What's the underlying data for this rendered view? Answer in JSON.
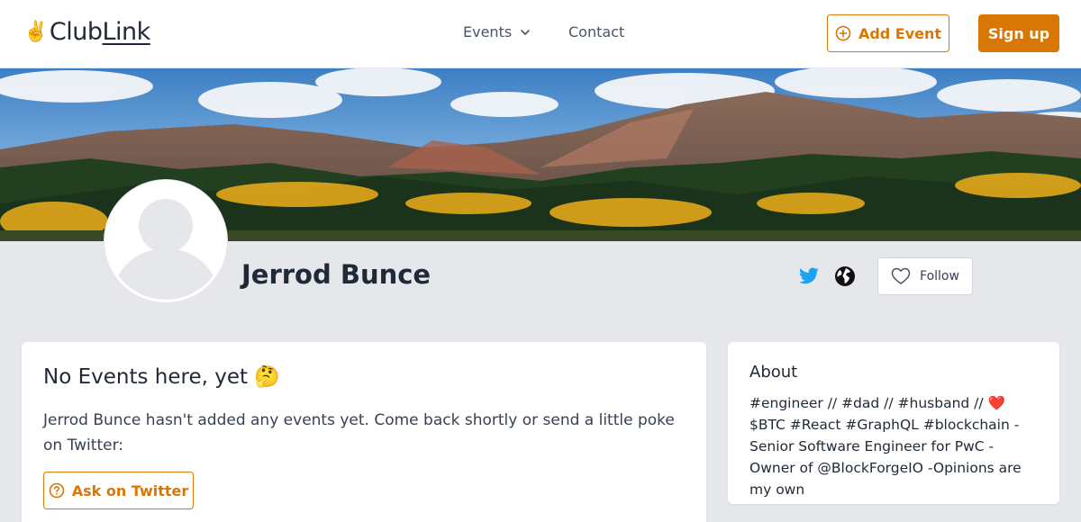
{
  "header": {
    "logo_emoji": "✌️",
    "logo_text_a": "Club",
    "logo_text_b": "Link",
    "nav_events": "Events",
    "nav_contact": "Contact",
    "add_event_label": "Add Event",
    "signup_label": "Sign up"
  },
  "profile": {
    "name": "Jerrod Bunce",
    "follow_label": "Follow"
  },
  "events": {
    "title": "No Events here, yet 🤔",
    "description": "Jerrod Bunce hasn't added any events yet. Come back shortly or send a little poke on Twitter:",
    "ask_button": "Ask on Twitter"
  },
  "about": {
    "title": "About",
    "text": "#engineer // #dad // #husband // ❤️ $BTC #React #GraphQL #blockchain - Senior Software Engineer for PwC - Owner of @BlockForgeIO -Opinions are my own"
  },
  "colors": {
    "accent": "#d97706",
    "twitter": "#1da1f2",
    "page_bg": "#e5e7eb"
  }
}
